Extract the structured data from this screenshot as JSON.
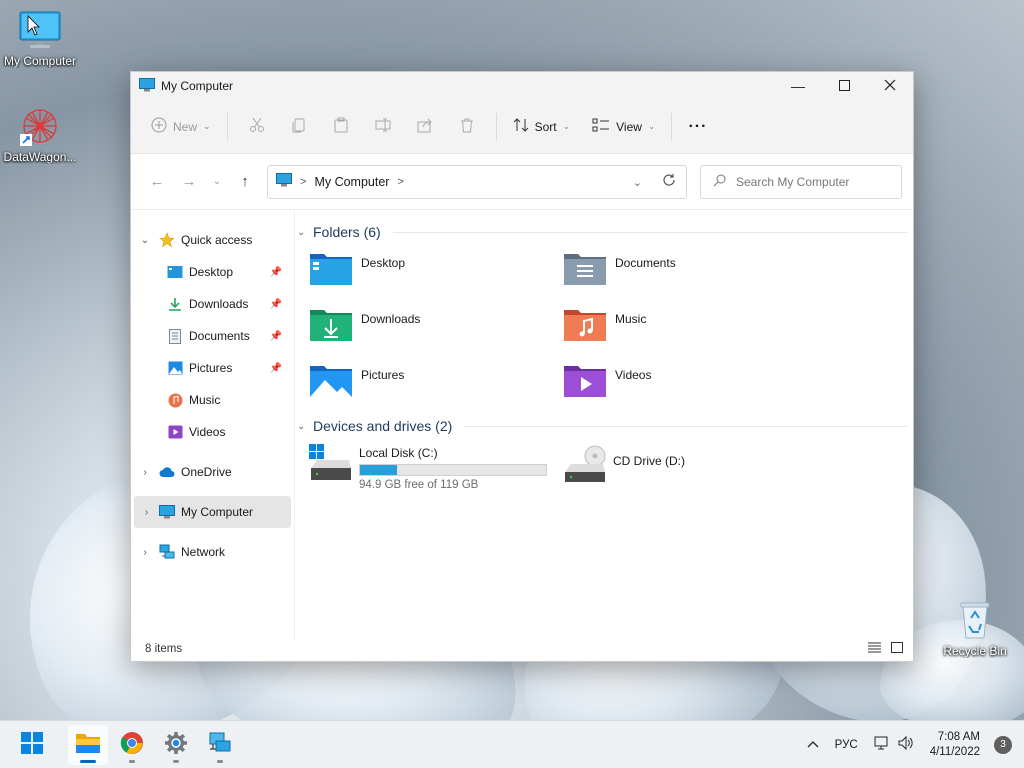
{
  "desktop": {
    "icons": [
      {
        "label": "My Computer",
        "icon": "computer-icon"
      },
      {
        "label": "DataWagon...",
        "icon": "datawagon-shortcut-icon"
      },
      {
        "label": "Recycle Bin",
        "icon": "recycle-bin-icon"
      }
    ]
  },
  "window": {
    "title": "My Computer",
    "toolbar": {
      "new_label": "New",
      "sort_label": "Sort",
      "view_label": "View",
      "more_label": "···"
    },
    "address": {
      "crumb": "My Computer",
      "separator": ">"
    },
    "search": {
      "placeholder": "Search My Computer"
    },
    "nav": {
      "quick_access": "Quick access",
      "quick_items": [
        {
          "label": "Desktop",
          "icon": "desktop-folder-icon",
          "pinned": true
        },
        {
          "label": "Downloads",
          "icon": "downloads-icon",
          "pinned": true
        },
        {
          "label": "Documents",
          "icon": "documents-icon",
          "pinned": true
        },
        {
          "label": "Pictures",
          "icon": "pictures-icon",
          "pinned": true
        },
        {
          "label": "Music",
          "icon": "music-icon",
          "pinned": false
        },
        {
          "label": "Videos",
          "icon": "videos-icon",
          "pinned": false
        }
      ],
      "onedrive": "OneDrive",
      "my_computer": "My Computer",
      "network": "Network"
    },
    "folders_header": "Folders (6)",
    "folders": [
      {
        "name": "Desktop",
        "icon": "desktop-folder-icon"
      },
      {
        "name": "Documents",
        "icon": "documents-folder-icon"
      },
      {
        "name": "Downloads",
        "icon": "downloads-folder-icon"
      },
      {
        "name": "Music",
        "icon": "music-folder-icon"
      },
      {
        "name": "Pictures",
        "icon": "pictures-folder-icon"
      },
      {
        "name": "Videos",
        "icon": "videos-folder-icon"
      }
    ],
    "drives_header": "Devices and drives (2)",
    "drives": [
      {
        "name": "Local Disk (C:)",
        "free": "94.9 GB free of 119 GB",
        "used_fraction": 0.2
      },
      {
        "name": "CD Drive (D:)"
      }
    ],
    "status": {
      "items": "8 items"
    }
  },
  "taskbar": {
    "apps": [
      "start-icon",
      "file-explorer-icon",
      "chrome-icon",
      "settings-icon",
      "network-app-icon"
    ],
    "lang": "РУС",
    "time": "7:08 AM",
    "date": "4/11/2022",
    "notifications": "3"
  },
  "colors": {
    "accent": "#0067c0",
    "drive_bar": "#26a0da",
    "folder_blue": "#1e90d8"
  }
}
